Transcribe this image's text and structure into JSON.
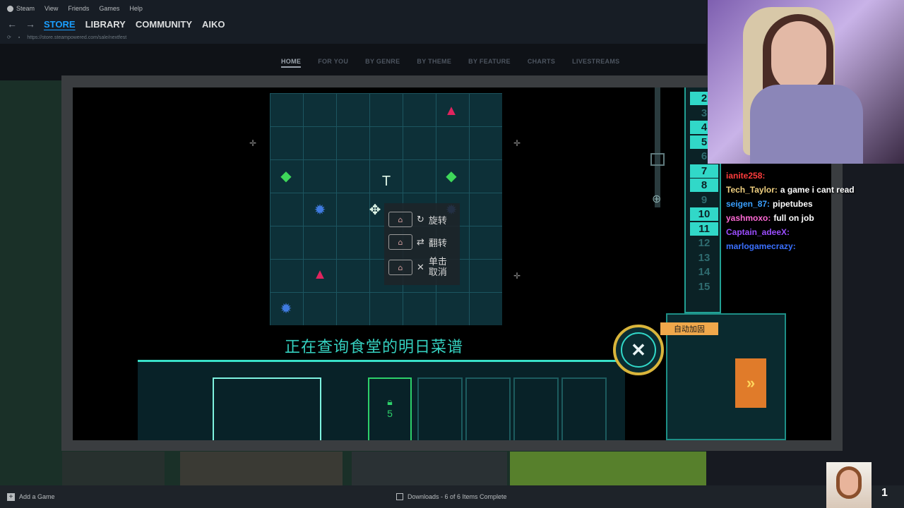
{
  "menubar": {
    "items": [
      "Steam",
      "View",
      "Friends",
      "Games",
      "Help"
    ]
  },
  "navbar": {
    "tabs": [
      "STORE",
      "LIBRARY",
      "COMMUNITY",
      "AIKO"
    ]
  },
  "urlbar": {
    "url": "https://store.steampowered.com/sale/nextfest"
  },
  "storenav": {
    "tabs": [
      "HOME",
      "FOR YOU",
      "BY GENRE",
      "BY THEME",
      "BY FEATURE",
      "CHARTS",
      "LIVESTREAMS"
    ]
  },
  "game": {
    "context_menu": [
      {
        "label": "旋转",
        "icon": "rotate-icon"
      },
      {
        "label": "翻转",
        "icon": "flip-icon"
      },
      {
        "label": "单击\n取消",
        "icon": "cancel-icon"
      }
    ],
    "subtitle": "正在查询食堂的明日菜谱",
    "numbers": [
      "2",
      "3",
      "4",
      "5",
      "6",
      "7",
      "8",
      "9",
      "10",
      "11",
      "12",
      "13",
      "14",
      "15"
    ],
    "lock_count": "5",
    "auto_button": "自动加固",
    "close_symbol": "✕",
    "ff_symbol": "»"
  },
  "chat": {
    "messages": [
      {
        "user": "ianite258:",
        "text": "",
        "color": "#ff3c3c"
      },
      {
        "user": "Tech_Taylor:",
        "text": "a game i cant read",
        "color": "#f0d080"
      },
      {
        "user": "seigen_87:",
        "text": "pipetubes",
        "color": "#3aa0ff"
      },
      {
        "user": "yashmoxo:",
        "text": "full on job",
        "color": "#ff6ad5"
      },
      {
        "user": "Captain_adeeX:",
        "text": "",
        "color": "#9b4dff"
      },
      {
        "user": "marlogamecrazy:",
        "text": "",
        "color": "#3a70ff"
      }
    ]
  },
  "bottombar": {
    "add_game": "Add a Game",
    "downloads": "Downloads - 6 of 6 Items Complete",
    "friends_count": "1"
  },
  "colors": {
    "accent": "#1a9fff",
    "game_teal": "#31d8c8",
    "game_orange": "#e07b2a"
  }
}
